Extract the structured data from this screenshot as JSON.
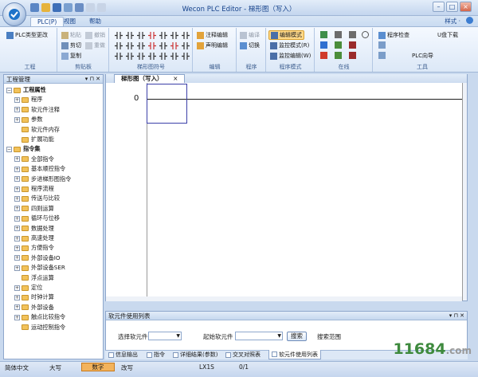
{
  "window": {
    "title": "Wecon PLC Editor - 梯形图（写入）",
    "controls": [
      "–",
      "□",
      "×"
    ]
  },
  "ribbon": {
    "tabs": [
      "PLC(P)",
      "视图",
      "帮助"
    ],
    "style_label": "样式 ·",
    "groups": {
      "project": {
        "label": "工程",
        "items": [
          "PLC类型更改"
        ]
      },
      "clipboard": {
        "label": "剪贴板",
        "items": [
          "粘贴",
          "剪切",
          "复制",
          "撤销",
          "重做"
        ]
      },
      "ladder_symbols": {
        "label": "梯形图符号"
      },
      "edit": {
        "label": "编辑",
        "items": [
          "注释编辑",
          "声明编辑"
        ]
      },
      "program": {
        "label": "程序",
        "items": [
          "编译",
          "切换"
        ]
      },
      "program_mode": {
        "label": "程序模式",
        "items": [
          "编辑模式",
          "监控模式(R)",
          "监控编辑(W)"
        ]
      },
      "online": {
        "label": "在线"
      },
      "tools": {
        "label": "工具",
        "items": [
          "程序检查",
          "U盘下载",
          "PLC向导"
        ]
      }
    }
  },
  "left_panel": {
    "title": "工程管理",
    "controls": "▾ ⊓ ✕",
    "tree": [
      {
        "label": "工程属性",
        "level": 0,
        "bold": true,
        "expand": "−"
      },
      {
        "label": "程序",
        "level": 1,
        "expand": "+"
      },
      {
        "label": "软元件注释",
        "level": 1,
        "expand": "+"
      },
      {
        "label": "参数",
        "level": 1,
        "expand": "+"
      },
      {
        "label": "软元件内存",
        "level": 1,
        "expand": ""
      },
      {
        "label": "扩展功能",
        "level": 1,
        "expand": ""
      },
      {
        "label": "指令集",
        "level": 0,
        "bold": true,
        "expand": "−"
      },
      {
        "label": "全部指令",
        "level": 1,
        "expand": "+"
      },
      {
        "label": "基本顺控指令",
        "level": 1,
        "expand": "+"
      },
      {
        "label": "步进梯形图指令",
        "level": 1,
        "expand": "+"
      },
      {
        "label": "程序流程",
        "level": 1,
        "expand": "+"
      },
      {
        "label": "传送与比较",
        "level": 1,
        "expand": "+"
      },
      {
        "label": "四则运算",
        "level": 1,
        "expand": "+"
      },
      {
        "label": "循环与位移",
        "level": 1,
        "expand": "+"
      },
      {
        "label": "数据处理",
        "level": 1,
        "expand": "+"
      },
      {
        "label": "高速处理",
        "level": 1,
        "expand": "+"
      },
      {
        "label": "方便指令",
        "level": 1,
        "expand": "+"
      },
      {
        "label": "外部设备IO",
        "level": 1,
        "expand": "+"
      },
      {
        "label": "外部设备SER",
        "level": 1,
        "expand": "+"
      },
      {
        "label": "浮点运算",
        "level": 1,
        "expand": ""
      },
      {
        "label": "定位",
        "level": 1,
        "expand": "+"
      },
      {
        "label": "时钟计算",
        "level": 1,
        "expand": "+"
      },
      {
        "label": "外部设备",
        "level": 1,
        "expand": "+"
      },
      {
        "label": "触点比较指令",
        "level": 1,
        "expand": "+"
      },
      {
        "label": "运动控制指令",
        "level": 1,
        "expand": ""
      }
    ]
  },
  "editor": {
    "tab_label": "梯形图（写入）",
    "tab_close": "×",
    "rung_number": "0"
  },
  "bottom_panel": {
    "title": "软元件使用列表",
    "controls": "▾ ⊓ ✕",
    "select_device_label": "选择软元件",
    "start_device_label": "起始软元件",
    "search_button": "搜索",
    "search_range_label": "搜索范围",
    "tabs": [
      "信息输出",
      "指令",
      "详细结果(参数)",
      "交叉对照表",
      "软元件使用列表"
    ]
  },
  "statusbar": {
    "language": "简体中文",
    "case": "大写",
    "mode": "数字",
    "edit": "改写",
    "model": "LX1S",
    "position": "0/1"
  },
  "watermark": {
    "main": "11684",
    "suffix": ".com"
  }
}
